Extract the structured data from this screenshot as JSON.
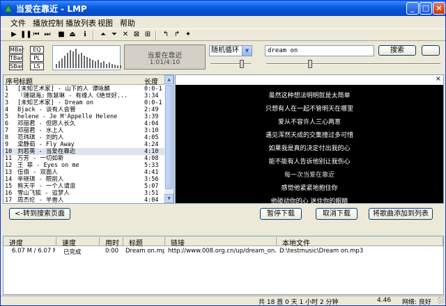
{
  "window": {
    "title": "当爱在靠近 - LMP",
    "min": "_",
    "max": "□",
    "close": "×"
  },
  "menu": [
    "文件",
    "播放控制",
    "播放列表",
    "视图",
    "帮助"
  ],
  "toolbar_icons": [
    "play-icon",
    "pause-icon",
    "prev-icon",
    "next-icon",
    "stop-icon",
    "eject-icon",
    "info-icon",
    "playlist-add-icon",
    "playlist-remove-icon",
    "delete-icon",
    "select-icon",
    "shuffle-icon",
    "back-icon",
    "forward-icon",
    "pin-icon"
  ],
  "toolbar_glyphs": [
    "▶",
    "❚❚",
    "⏮",
    "⏭",
    "■",
    "⏏",
    "ℹ",
    "⏶",
    "⏷",
    "✕",
    "⊠",
    "⊞",
    "↰",
    "↱",
    "✦"
  ],
  "panel": {
    "buttons": [
      "MBar",
      "EQ",
      "TBar",
      "PL",
      "SBar",
      "LS"
    ],
    "now_title": "当爱在靠近",
    "now_time": "1:01/4:10",
    "mode": "随机循环",
    "search_value": "dream on",
    "search_label": "搜索",
    "extra_label": ""
  },
  "playlist": {
    "headers": {
      "num": "序号",
      "title": "标题",
      "length": "长度"
    },
    "rows": [
      {
        "num": "1",
        "title": "[未知艺术家] - 山下的人 谭咏麟",
        "length": "0:0-1"
      },
      {
        "num": "2",
        "title": "『珊瑚海』陈慧琳 - 有缘人《绝世好...",
        "length": "3:34"
      },
      {
        "num": "3",
        "title": "[未知艺术家] - Dream on",
        "length": "0:0-1"
      },
      {
        "num": "4",
        "title": "Bjack - 谈有人会管",
        "length": "2:49"
      },
      {
        "num": "5",
        "title": "helene - Je M'Appelle Helene",
        "length": "3:39"
      },
      {
        "num": "6",
        "title": "邓丽君 - 但愿人长久",
        "length": "4:04"
      },
      {
        "num": "7",
        "title": "邓丽君 - 水上人",
        "length": "3:10"
      },
      {
        "num": "8",
        "title": "范玮琪 - 刘的人",
        "length": "4:05"
      },
      {
        "num": "9",
        "title": "梁静茹 - Fly Away",
        "length": "4:24"
      },
      {
        "num": "10",
        "title": "刘若英 - 当爱在靠近",
        "length": "4:10"
      },
      {
        "num": "11",
        "title": "万芳 - 一切如新",
        "length": "4:08"
      },
      {
        "num": "12",
        "title": "王 菲 - Eyes on me",
        "length": "5:33"
      },
      {
        "num": "13",
        "title": "伍佰 - 双面人",
        "length": "4:41"
      },
      {
        "num": "14",
        "title": "辛晓琪 - 眼前人",
        "length": "3:56"
      },
      {
        "num": "15",
        "title": "熊天平 - 一个人请浪",
        "length": "5:07"
      },
      {
        "num": "16",
        "title": "雪山飞狐 - 追梦人",
        "length": "3:51"
      },
      {
        "num": "17",
        "title": "周杰伦 - 半兽人",
        "length": "4:04"
      }
    ]
  },
  "lyrics": {
    "close": "×",
    "lines": [
      "虽然这种想法明明就是太简单",
      "只想有人在一起不管明天在哪里",
      "爱从不容许人三心两意",
      "遇见浑然天成的交集撞过多可惜",
      "如果我是真的决定付出我的心",
      "能不能有人告诉他别让我伤心",
      "每一次当爱在靠近",
      "感觉他紧紧地抱住你",
      "他碰动你的心 迷住你的眼睛"
    ],
    "current_line": 6
  },
  "actions": {
    "back_to_search": "<-转到搜索页面",
    "pause_dl": "暂停下载",
    "cancel_dl": "取消下载",
    "add_to_list": "将歌曲添加到列表"
  },
  "downloads": {
    "headers": [
      "进度",
      "速度",
      "用时",
      "标题",
      "链接",
      "本地文件"
    ],
    "rows": [
      {
        "progress": "6.07 M / 6.07 M",
        "speed": "已完成",
        "time": "0:00",
        "title": "Dream on.mp3",
        "link": "http://www.008.org.cn/up/dream_on.mp3",
        "local": "D:\\testmusic\\Dream on.mp3"
      }
    ]
  },
  "status": {
    "summary": "共 18 首   0 天 1 小时 2 分钟",
    "version": "4.46",
    "network": "网络: 良好"
  }
}
